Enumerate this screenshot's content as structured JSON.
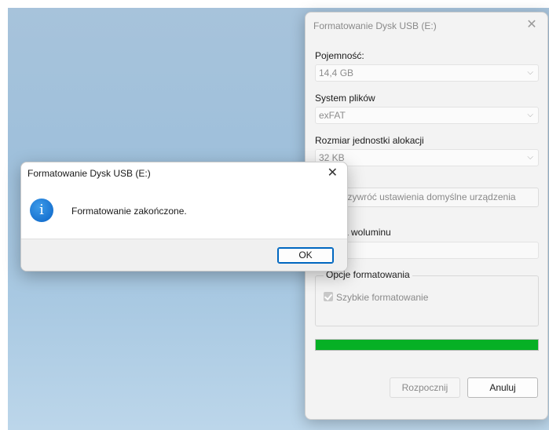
{
  "format_dialog": {
    "title": "Formatowanie Dysk USB (E:)",
    "capacity_label": "Pojemność:",
    "capacity_value": "14,4 GB",
    "filesystem_label": "System plików",
    "filesystem_value": "exFAT",
    "allocation_label": "Rozmiar jednostki alokacji",
    "allocation_value": "32 KB",
    "restore_defaults_label": "Przywróć ustawienia domyślne urządzenia",
    "volume_label_label": "Etykieta woluminu",
    "volume_label_value": "",
    "options_group_label": "Opcje formatowania",
    "quick_format_label": "Szybkie formatowanie",
    "quick_format_checked": true,
    "progress_fraction": 1.0,
    "start_button": "Rozpocznij",
    "cancel_button": "Anuluj",
    "colors": {
      "progress": "#06b025"
    }
  },
  "message_box": {
    "title": "Formatowanie Dysk USB (E:)",
    "icon": "info-icon",
    "message": "Formatowanie zakończone.",
    "ok_button": "OK",
    "colors": {
      "icon": "#0a63c7"
    }
  }
}
